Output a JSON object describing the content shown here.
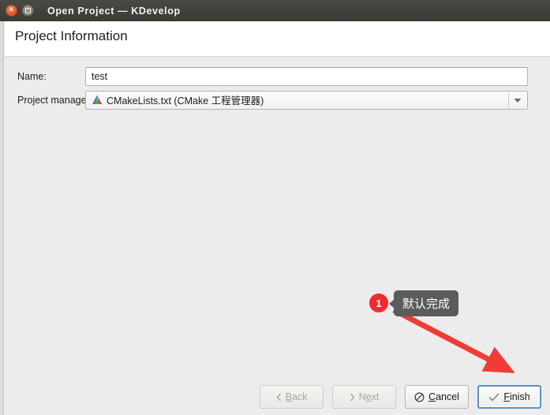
{
  "window": {
    "title": "Open Project — KDevelop",
    "close_icon": "close-icon",
    "maximize_icon": "maximize-icon"
  },
  "dialog": {
    "header_title": "Project Information"
  },
  "form": {
    "fields": [
      {
        "label": "Name:",
        "type": "text",
        "value": "test",
        "placeholder": ""
      },
      {
        "label": "Project manager:",
        "type": "combobox",
        "value": "CMakeLists.txt (CMake 工程管理器)",
        "icon": "cmake-triangle-icon",
        "arrow_icon": "chevron-down-icon"
      }
    ]
  },
  "annotation": {
    "badge_number": "1",
    "tooltip_text": "默认完成",
    "badge_color": "#f32a2f",
    "tooltip_bg": "#5b5b5b",
    "arrow_color": "#f03c36",
    "arrow_from": "498,392",
    "arrow_to": "634,463"
  },
  "buttons": {
    "back": {
      "label": "Back",
      "icon": "chevron-left-icon",
      "disabled": true
    },
    "next": {
      "label": "Next",
      "icon": "chevron-right-icon",
      "disabled": true
    },
    "cancel": {
      "label": "Cancel",
      "icon": "no-entry-icon",
      "disabled": false
    },
    "finish": {
      "label": "Finish",
      "icon": "check-icon",
      "disabled": false,
      "focus_color": "#5792c6"
    }
  }
}
